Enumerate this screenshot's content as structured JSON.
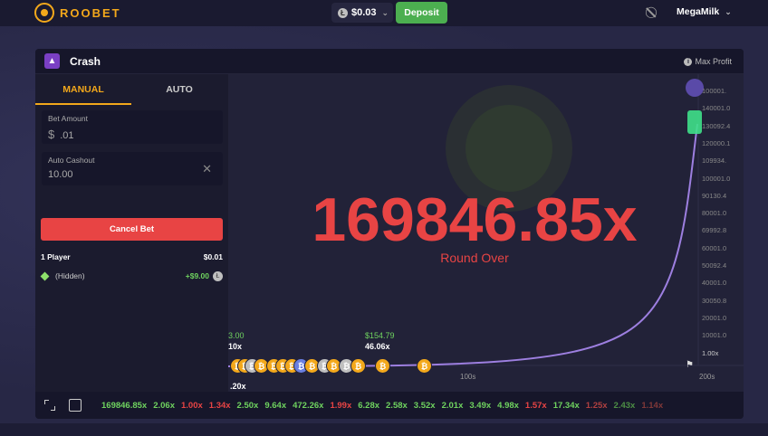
{
  "topbar": {
    "logo_text": "ROOBET",
    "balance": "$0.03",
    "deposit_label": "Deposit",
    "username": "MegaMilk"
  },
  "game": {
    "title": "Crash",
    "max_profit_label": "Max Profit",
    "tabs": [
      "MANUAL",
      "AUTO"
    ],
    "bet_amount_label": "Bet Amount",
    "bet_amount_value": ".01",
    "currency_symbol": "$",
    "auto_cashout_label": "Auto Cashout",
    "auto_cashout_value": "10.00",
    "cancel_label": "Cancel Bet",
    "players_label": "1 Player",
    "players_total": "$0.01",
    "player": {
      "name": "(Hidden)",
      "win": "+$9.00"
    }
  },
  "chart_data": {
    "type": "line",
    "multiplier": "169846.85x",
    "status": "Round Over",
    "y_ticks": [
      "100001.",
      "140001.0",
      "130092.4",
      "120000.1",
      "109934.",
      "100001.0",
      "90130.4",
      "80001.0",
      "69992.8",
      "60001.0",
      "50092.4",
      "40001.0",
      "30050.8",
      "20001.0",
      "10001.0",
      "1.00x"
    ],
    "x_ticks": [
      "100s",
      "200s"
    ],
    "cashouts": [
      {
        "amount": "3.00",
        "mult": "10x"
      },
      {
        "amount": "$154.79",
        "mult": "46.06x"
      }
    ],
    "bottom_mult": ".20x"
  },
  "history": [
    {
      "value": "169846.85x",
      "color": "#6fd35f"
    },
    {
      "value": "2.06x",
      "color": "#6fd35f"
    },
    {
      "value": "1.00x",
      "color": "#e84444"
    },
    {
      "value": "1.34x",
      "color": "#e84444"
    },
    {
      "value": "2.50x",
      "color": "#6fd35f"
    },
    {
      "value": "9.64x",
      "color": "#6fd35f"
    },
    {
      "value": "472.26x",
      "color": "#6fd35f"
    },
    {
      "value": "1.99x",
      "color": "#e84444"
    },
    {
      "value": "6.28x",
      "color": "#6fd35f"
    },
    {
      "value": "2.58x",
      "color": "#6fd35f"
    },
    {
      "value": "3.52x",
      "color": "#6fd35f"
    },
    {
      "value": "2.01x",
      "color": "#6fd35f"
    },
    {
      "value": "3.49x",
      "color": "#6fd35f"
    },
    {
      "value": "4.98x",
      "color": "#6fd35f"
    },
    {
      "value": "1.57x",
      "color": "#e84444"
    },
    {
      "value": "17.34x",
      "color": "#6fd35f"
    },
    {
      "value": "1.25x",
      "color": "#b04040"
    },
    {
      "value": "2.43x",
      "color": "#4d8f45"
    },
    {
      "value": "1.14x",
      "color": "#803838"
    }
  ]
}
